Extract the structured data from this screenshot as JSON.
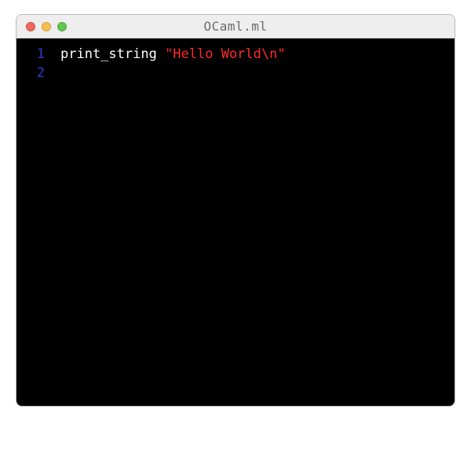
{
  "window": {
    "title": "OCaml.ml"
  },
  "editor": {
    "lines": [
      {
        "number": "1"
      },
      {
        "number": "2"
      }
    ],
    "code": {
      "func": "print_string ",
      "string": "\"Hello World\\n\""
    }
  },
  "colors": {
    "titlebar_bg": "#eeeeee",
    "editor_bg": "#000000",
    "line_number": "#2b3fce",
    "func_color": "#ffffff",
    "string_color": "#ff2a2a"
  }
}
